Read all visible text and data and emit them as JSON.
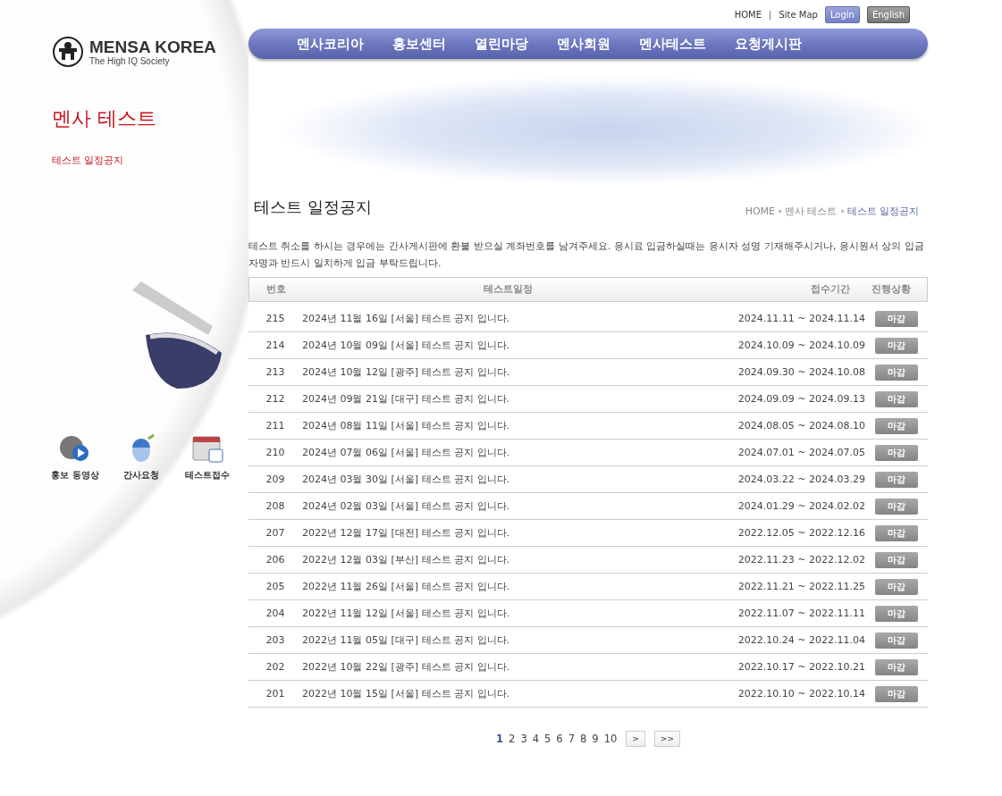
{
  "top_links": [
    {
      "label": "HOME",
      "kind": "link"
    },
    {
      "label": "|",
      "kind": "separator"
    },
    {
      "label": "Site Map",
      "kind": "link"
    },
    {
      "label": "Login",
      "kind": "login"
    },
    {
      "label": "English",
      "kind": "lang"
    }
  ],
  "logo": {
    "name": "MENSA KOREA",
    "tagline": "The High IQ Society"
  },
  "nav": [
    "멘사코리아",
    "홍보센터",
    "열린마당",
    "멘사회원",
    "멘사테스트",
    "요청게시판"
  ],
  "sidebar": {
    "title": "멘사 테스트",
    "items": [
      {
        "label": "테스트 일정공지",
        "selected": true
      }
    ],
    "quick_links": [
      {
        "label": "홍보 동영상",
        "kind": "video"
      },
      {
        "label": "간사요청",
        "kind": "mouse"
      },
      {
        "label": "테스트접수",
        "kind": "calendar"
      }
    ]
  },
  "page_title": "테스트 일정공지",
  "breadcrumb": [
    "HOME",
    "멘사 테스트",
    "테스트 일정공지"
  ],
  "notice": "테스트 취소를 하시는 경우에는 간사게시판에 환불 받으실 계좌번호를 남겨주세요. 응시료 입금하실때는 응시자 성명 기재해주시거나, 응시원서 상의 입금자명과 반드시 일치하게 입금 부탁드립니다.",
  "table": {
    "columns": [
      "번호",
      "테스트일정",
      "접수기간",
      "진행상황"
    ],
    "rows": [
      {
        "num": "215",
        "title": "2024년 11월 16일 [서울] 테스트 공지 입니다.",
        "period": "2024.11.11 ~ 2024.11.14",
        "status": "마감"
      },
      {
        "num": "214",
        "title": "2024년 10월 09일 [서울] 테스트 공지 입니다.",
        "period": "2024.10.09 ~ 2024.10.09",
        "status": "마감"
      },
      {
        "num": "213",
        "title": "2024년 10월 12일 [광주] 테스트 공지 입니다.",
        "period": "2024.09.30 ~ 2024.10.08",
        "status": "마감"
      },
      {
        "num": "212",
        "title": "2024년 09월 21일 [대구] 테스트 공지 입니다.",
        "period": "2024.09.09 ~ 2024.09.13",
        "status": "마감"
      },
      {
        "num": "211",
        "title": "2024년 08월 11일 [서울] 테스트 공지 입니다.",
        "period": "2024.08.05 ~ 2024.08.10",
        "status": "마감"
      },
      {
        "num": "210",
        "title": "2024년 07월 06일 [서울] 테스트 공지 입니다.",
        "period": "2024.07.01 ~ 2024.07.05",
        "status": "마감"
      },
      {
        "num": "209",
        "title": "2024년 03월 30일 [서울] 테스트 공지 입니다.",
        "period": "2024.03.22 ~ 2024.03.29",
        "status": "마감"
      },
      {
        "num": "208",
        "title": "2024년 02월 03일 [서울] 테스트 공지 입니다.",
        "period": "2024.01.29 ~ 2024.02.02",
        "status": "마감"
      },
      {
        "num": "207",
        "title": "2022년 12월 17일 [대전] 테스트 공지 입니다.",
        "period": "2022.12.05 ~ 2022.12.16",
        "status": "마감"
      },
      {
        "num": "206",
        "title": "2022년 12월 03일 [부산] 테스트 공지 입니다.",
        "period": "2022.11.23 ~ 2022.12.02",
        "status": "마감"
      },
      {
        "num": "205",
        "title": "2022년 11월 26일 [서울] 테스트 공지 입니다.",
        "period": "2022.11.21 ~ 2022.11.25",
        "status": "마감"
      },
      {
        "num": "204",
        "title": "2022년 11월 12일 [서울] 테스트 공지 입니다.",
        "period": "2022.11.07 ~ 2022.11.11",
        "status": "마감"
      },
      {
        "num": "203",
        "title": "2022년 11월 05일 [대구] 테스트 공지 입니다.",
        "period": "2022.10.24 ~ 2022.11.04",
        "status": "마감"
      },
      {
        "num": "202",
        "title": "2022년 10월 22일 [광주] 테스트 공지 입니다.",
        "period": "2022.10.17 ~ 2022.10.21",
        "status": "마감"
      },
      {
        "num": "201",
        "title": "2022년 10월 15일 [서울] 테스트 공지 입니다.",
        "period": "2022.10.10 ~ 2022.10.14",
        "status": "마감"
      }
    ]
  },
  "pagination": {
    "pages": [
      {
        "label": "1",
        "selected": true
      },
      {
        "label": "2",
        "selected": false
      },
      {
        "label": "3",
        "selected": false
      },
      {
        "label": "4",
        "selected": false
      },
      {
        "label": "5",
        "selected": false
      },
      {
        "label": "6",
        "selected": false
      },
      {
        "label": "7",
        "selected": false
      },
      {
        "label": "8",
        "selected": false
      },
      {
        "label": "9",
        "selected": false
      },
      {
        "label": "10",
        "selected": false
      }
    ],
    "next": ">",
    "last": ">>"
  }
}
